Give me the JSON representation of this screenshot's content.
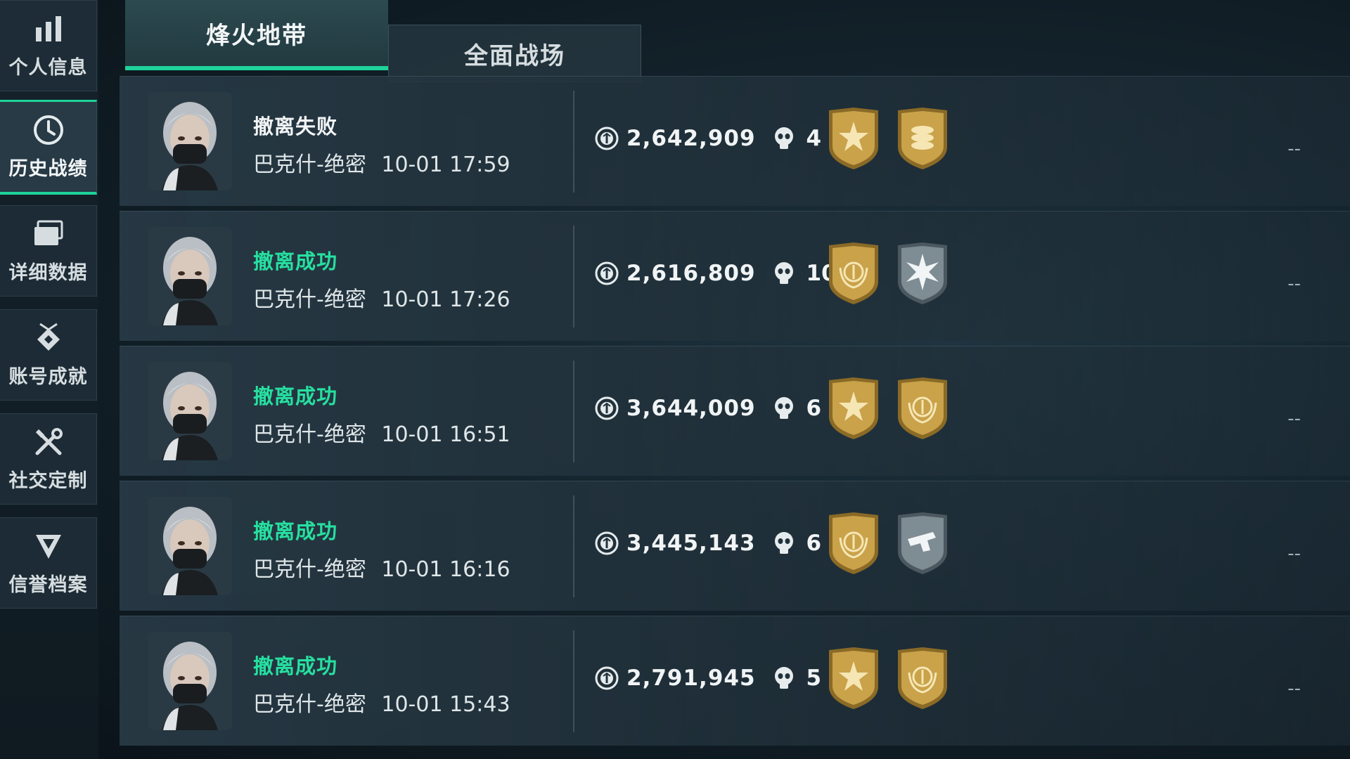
{
  "sidebar": {
    "items": [
      {
        "label": "个人信息",
        "icon": "bar-chart-icon"
      },
      {
        "label": "历史战绩",
        "icon": "clock-icon"
      },
      {
        "label": "详细数据",
        "icon": "folder-icon"
      },
      {
        "label": "账号成就",
        "icon": "achievement-icon"
      },
      {
        "label": "社交定制",
        "icon": "tools-icon"
      },
      {
        "label": "信誉档案",
        "icon": "shield-icon"
      }
    ]
  },
  "tabs": [
    {
      "label": "烽火地带"
    },
    {
      "label": "全面战场"
    }
  ],
  "records": [
    {
      "status": "撤离失败",
      "map": "巴克什-绝密",
      "time": "10-01 17:59",
      "value": "2,642,909",
      "kills": "4",
      "badges": [
        "gold-star-badge",
        "gold-stack-badge"
      ],
      "dash": "--"
    },
    {
      "status": "撤离成功",
      "map": "巴克什-绝密",
      "time": "10-01 17:26",
      "value": "2,616,809",
      "kills": "10",
      "badges": [
        "gold-laurel-badge",
        "silver-burst-badge"
      ],
      "dash": "--"
    },
    {
      "status": "撤离成功",
      "map": "巴克什-绝密",
      "time": "10-01 16:51",
      "value": "3,644,009",
      "kills": "6",
      "badges": [
        "gold-star-badge",
        "gold-laurel-badge"
      ],
      "dash": "--"
    },
    {
      "status": "撤离成功",
      "map": "巴克什-绝密",
      "time": "10-01 16:16",
      "value": "3,445,143",
      "kills": "6",
      "badges": [
        "gold-laurel-badge",
        "silver-gun-badge"
      ],
      "dash": "--"
    },
    {
      "status": "撤离成功",
      "map": "巴克什-绝密",
      "time": "10-01 15:43",
      "value": "2,791,945",
      "kills": "5",
      "badges": [
        "gold-star-badge",
        "gold-laurel-badge"
      ],
      "dash": "--"
    }
  ],
  "colors": {
    "accent": "#1ed39a",
    "success": "#26e0a0",
    "gold": "#c9a24a",
    "silver": "#8a98a0"
  }
}
